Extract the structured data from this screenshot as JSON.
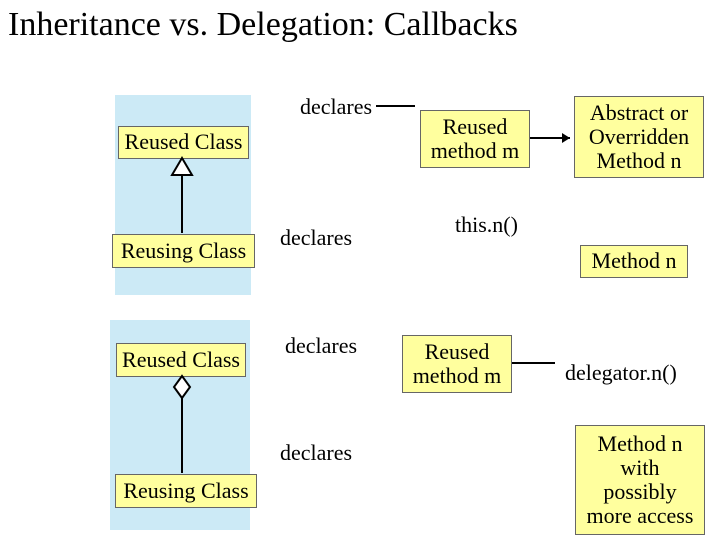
{
  "title": "Inheritance vs. Delegation: Callbacks",
  "top": {
    "declares1": "declares",
    "reused_class": "Reused Class",
    "reused_method": "Reused\nmethod m",
    "abstract_method": "Abstract or\nOverridden\nMethod n",
    "reusing_class": "Reusing Class",
    "declares2": "declares",
    "thisn": "this.n()",
    "method_n": "Method n"
  },
  "bottom": {
    "reused_class": "Reused Class",
    "declares1": "declares",
    "reused_method": "Reused\nmethod m",
    "delegator": "delegator.n()",
    "reusing_class": "Reusing Class",
    "declares2": "declares",
    "method_n": "Method n\nwith\npossibly\nmore access"
  }
}
